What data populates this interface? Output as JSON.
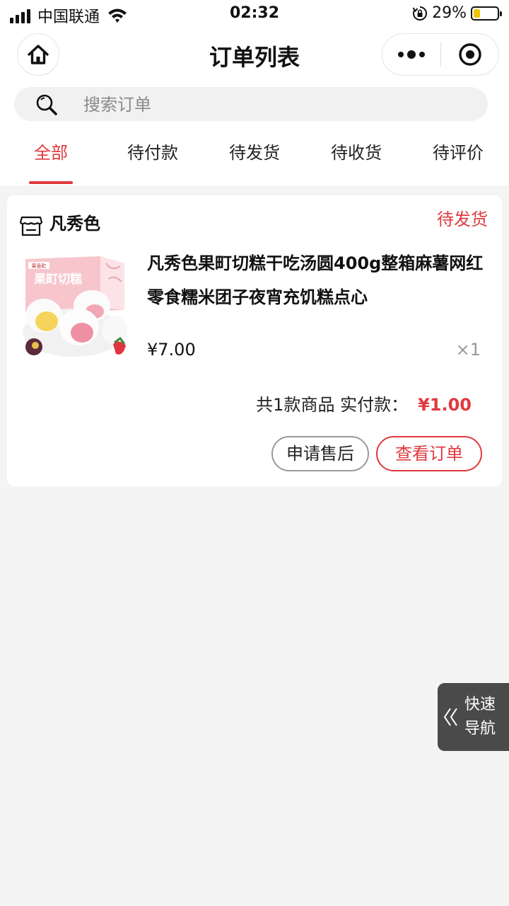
{
  "status_bar": {
    "carrier": "中国联通",
    "time": "02:32",
    "battery_percent": "29%",
    "battery_level": 0.29,
    "icons": [
      "signal-icon",
      "wifi-icon",
      "rotation-lock-icon",
      "battery-icon"
    ]
  },
  "nav": {
    "title": "订单列表",
    "home_icon": "home-icon",
    "more_icon": "more-icon",
    "close_icon": "close-miniprogram-icon"
  },
  "search": {
    "placeholder": "搜索订单",
    "value": "",
    "icon": "search-icon"
  },
  "tabs": [
    {
      "label": "全部",
      "active": true
    },
    {
      "label": "待付款",
      "active": false
    },
    {
      "label": "待发货",
      "active": false
    },
    {
      "label": "待收货",
      "active": false
    },
    {
      "label": "待评价",
      "active": false
    }
  ],
  "orders": [
    {
      "shop_name": "凡秀色",
      "shop_icon": "store-icon",
      "status": "待发货",
      "product": {
        "title": "凡秀色果町切糕干吃汤圆400g整箱麻薯网红零食糯米团子夜宵充饥糕点心",
        "price": "¥7.00",
        "quantity": "×1",
        "image_text": "果町切糕"
      },
      "summary_label": "共1款商品 实付款：",
      "paid_amount": "¥1.00",
      "buttons": {
        "after_sale": "申请售后",
        "view_order": "查看订单"
      }
    }
  ],
  "quick_nav": {
    "line1": "快速",
    "line2": "导航",
    "icon": "double-chevron-left-icon"
  },
  "colors": {
    "accent": "#e0393e",
    "background": "#f4f4f4",
    "quick_nav_bg": "#4a4a4a"
  }
}
